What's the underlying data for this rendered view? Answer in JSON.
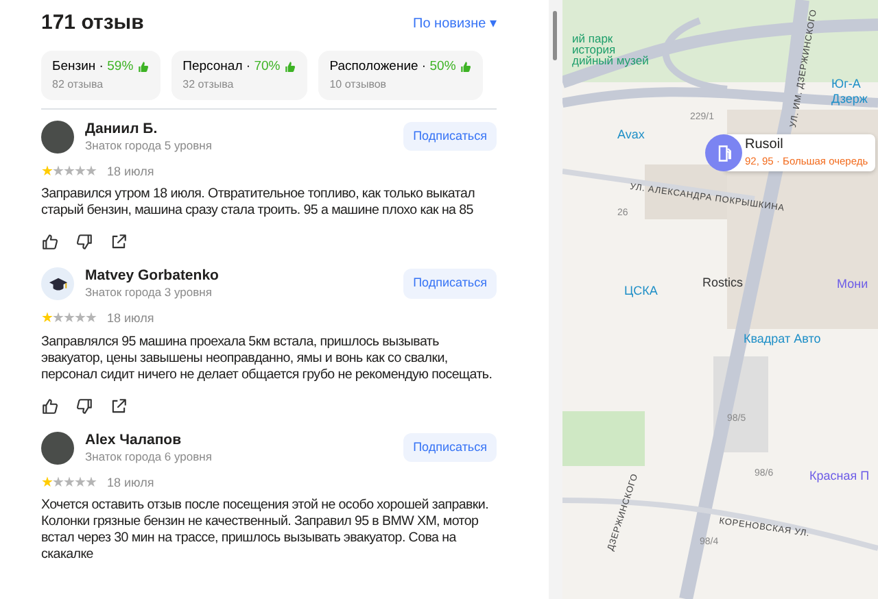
{
  "header": {
    "title": "171 отзыв",
    "sort": "По новизне",
    "sort_caret": "▾"
  },
  "aspects": [
    {
      "name": "Бензин ·",
      "percent": "59%",
      "count": "82 отзыва"
    },
    {
      "name": "Персонал ·",
      "percent": "70%",
      "count": "32 отзыва"
    },
    {
      "name": "Расположение ·",
      "percent": "50%",
      "count": "10 отзывов"
    }
  ],
  "reviews": [
    {
      "author": "Даниил Б.",
      "level": "Знаток города 5 уровня",
      "kind": "photo",
      "subscribe": "Подписаться",
      "stars": 1,
      "date": "18 июля",
      "text": "Заправился утром 18 июля. Отвратительное топливо, как только выкатал старый бензин, машина сразу стала троить. 95 а машине плохо как на 85",
      "actions": true
    },
    {
      "author": "Matvey Gorbatenko",
      "level": "Знаток города 3 уровня",
      "kind": "cap",
      "subscribe": "Подписаться",
      "stars": 1,
      "date": "18 июля",
      "text": "Заправлялся 95 машина проехала 5км встала, пришлось вызывать эвакуатор, цены завышены неоправданно, ямы и вонь как со свалки, персонал сидит ничего не делает общается грубо не рекомендую посещать.",
      "actions": true
    },
    {
      "author": "Alex Чалапов",
      "level": "Знаток города 6 уровня",
      "kind": "photo",
      "subscribe": "Подписаться",
      "stars": 1,
      "date": "18 июля",
      "text": "Хочется оставить отзыв после посещения этой не особо хорошей заправки. Колонки грязные бензин не качественный. Заправил 95 в BMW XM, мотор встал через 30 мин на трассе, пришлось вызывать эвакуатор. Сова на скакалке",
      "actions": false
    }
  ],
  "map": {
    "pin": {
      "title": "Rusoil",
      "fuels": "92, 95",
      "note": "· Большая очередь"
    },
    "labels": [
      {
        "text": "Avax",
        "kind": "poi"
      },
      {
        "text": "ЦСКА",
        "kind": "poi"
      },
      {
        "text": "Rostics",
        "kind": "poi-dark"
      },
      {
        "text": "Квадрат Авто",
        "kind": "poi"
      },
      {
        "text": "Красная П",
        "kind": "poi-violet"
      },
      {
        "text": "Юг-А",
        "kind": "poi"
      },
      {
        "text": "Дзерж",
        "kind": "poi"
      },
      {
        "text": "ий парк",
        "kind": "park"
      },
      {
        "text": "история",
        "kind": "park"
      },
      {
        "text": "дийный музей",
        "kind": "park"
      },
      {
        "text": "Мони",
        "kind": "poi-violet"
      },
      {
        "text": "УЛ. АЛЕКСАНДРА ПОКРЫШКИНА",
        "kind": "street"
      },
      {
        "text": "КОРЕНОВСКАЯ УЛ.",
        "kind": "street"
      },
      {
        "text": "УЛ. ИМ. ДЗЕРЖИНСКОГО",
        "kind": "street-v"
      },
      {
        "text": "ДЗЕРЖИНСКОГО",
        "kind": "street-v2"
      },
      {
        "text": "229/1",
        "kind": "house"
      },
      {
        "text": "26",
        "kind": "house"
      },
      {
        "text": "98/5",
        "kind": "house"
      },
      {
        "text": "98/6",
        "kind": "house"
      },
      {
        "text": "98/4",
        "kind": "house"
      }
    ]
  }
}
